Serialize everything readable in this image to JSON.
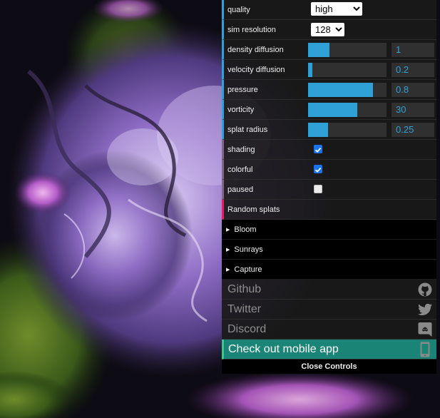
{
  "controls": {
    "quality": {
      "label": "quality",
      "value": "high",
      "options": [
        "high"
      ]
    },
    "sim_resolution": {
      "label": "sim resolution",
      "value": "128",
      "options": [
        "128"
      ]
    },
    "density_diffusion": {
      "label": "density diffusion",
      "value": "1",
      "fill_fraction": 0.27
    },
    "velocity_diffusion": {
      "label": "velocity diffusion",
      "value": "0.2",
      "fill_fraction": 0.05
    },
    "pressure": {
      "label": "pressure",
      "value": "0.8",
      "fill_fraction": 0.83
    },
    "vorticity": {
      "label": "vorticity",
      "value": "30",
      "fill_fraction": 0.63
    },
    "splat_radius": {
      "label": "splat radius",
      "value": "0.25",
      "fill_fraction": 0.25
    },
    "shading": {
      "label": "shading",
      "checked": true
    },
    "colorful": {
      "label": "colorful",
      "checked": true
    },
    "paused": {
      "label": "paused",
      "checked": false
    },
    "random_splats": {
      "label": "Random splats"
    }
  },
  "folders": {
    "bloom": "Bloom",
    "sunrays": "Sunrays",
    "capture": "Capture"
  },
  "links": {
    "github": {
      "label": "Github",
      "icon": "github-icon"
    },
    "twitter": {
      "label": "Twitter",
      "icon": "twitter-icon"
    },
    "discord": {
      "label": "Discord",
      "icon": "discord-icon"
    },
    "mobile": {
      "label": "Check out mobile app",
      "icon": "smartphone-icon"
    }
  },
  "close_label": "Close Controls",
  "colors": {
    "accent": "#2fa1d6",
    "mobile_bg": "#1a8476",
    "fn_border": "#e61d5f"
  }
}
